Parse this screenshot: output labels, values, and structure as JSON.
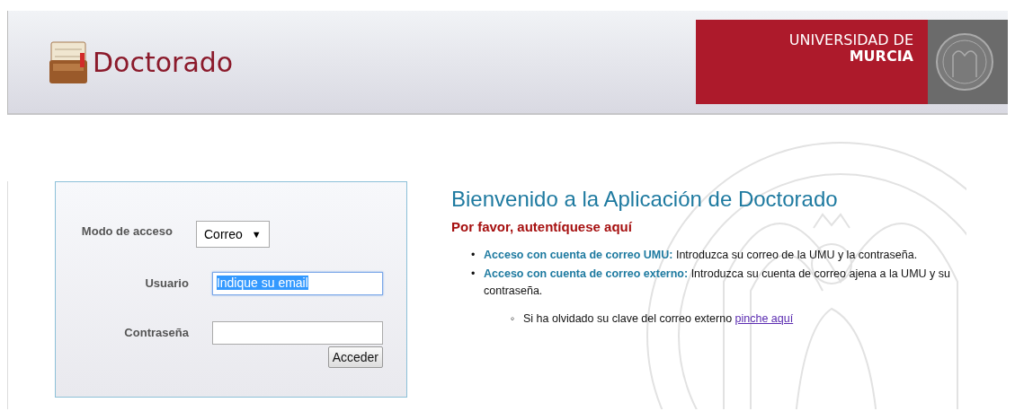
{
  "header": {
    "app_title": "Doctorado",
    "university_line_1": "UNIVERSIDAD DE",
    "university_line_2": "MURCIA"
  },
  "login_form": {
    "fields": [
      {
        "kind": "select",
        "label": "Modo de acceso",
        "value": "Correo",
        "arrow": "▼"
      },
      {
        "kind": "text",
        "label": "Usuario",
        "value": "Indique su email",
        "value_selected": true
      },
      {
        "kind": "password",
        "label": "Contraseña"
      }
    ],
    "submit_button": "Acceder"
  },
  "welcome": {
    "title": "Bienvenido a la Aplicación de Doctorado",
    "subtitle": "Por favor, autentíquese aquí",
    "bullets": [
      {
        "marker": "•",
        "lead": "Acceso con cuenta de correo UMU:",
        "text": " Introduzca su correo de la UMU y la contraseña."
      },
      {
        "marker": "•",
        "lead": "Acceso con cuenta de correo externo:",
        "text": " Introduzca su cuenta de correo ajena a la UMU y su contraseña.",
        "sub_items": [
          {
            "marker": "◦",
            "text": "Si ha olvidado su clave del correo externo ",
            "link": "pinche aquí"
          }
        ]
      }
    ]
  }
}
